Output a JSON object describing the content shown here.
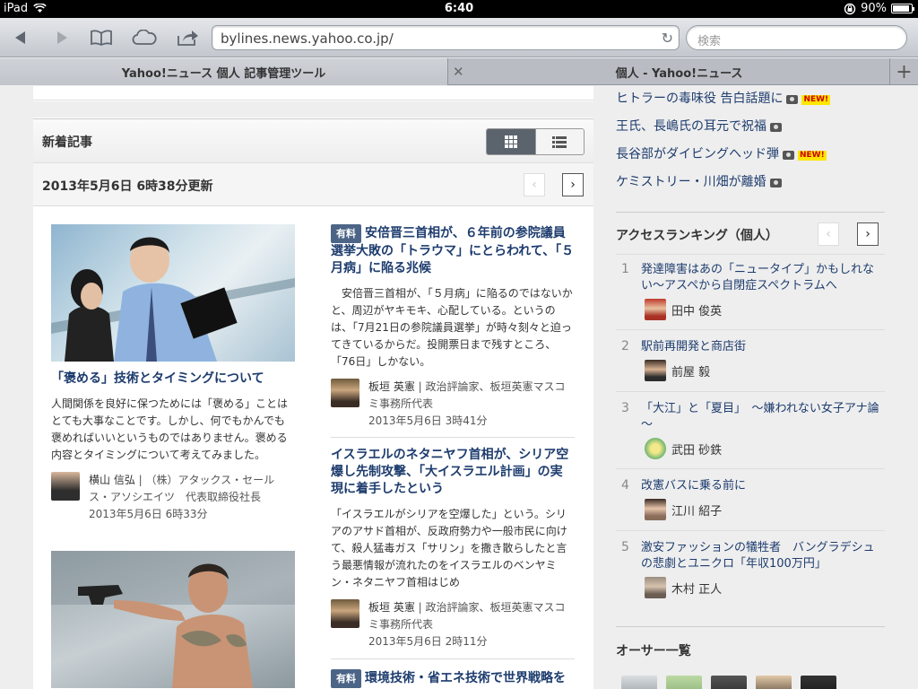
{
  "status_bar": {
    "device": "iPad",
    "time": "6:40",
    "battery": "90%",
    "battery_level": 0.9
  },
  "toolbar": {
    "url": "bylines.news.yahoo.co.jp/",
    "search_placeholder": "検索"
  },
  "tabs": [
    {
      "label": "Yahoo!ニュース 個人 記事管理ツール",
      "active": true
    },
    {
      "label": "個人 - Yahoo!ニュース",
      "active": false
    }
  ],
  "section": {
    "title": "新着記事",
    "updated": "2013年5月6日 6時38分更新"
  },
  "articles_left": [
    {
      "title": "「褒める」技術とタイミングについて",
      "body": "人間関係を良好に保つためには「褒める」ことはとても大事なことです。しかし、何でもかんでも褒めればいいというものではありません。褒める内容とタイミングについて考えてみました。",
      "author_name": "横山 信弘",
      "author_role": "（株）アタックス・セールス・アソシエイツ　代表取締役社長",
      "time": "2013年5月6日 6時33分"
    }
  ],
  "articles_right": [
    {
      "badge": "有料",
      "title": "安倍晋三首相が、６年前の参院議員選挙大敗の「トラウマ」にとらわれて、「５月病」に陥る兆候",
      "body": "安倍晋三首相が、「５月病」に陥るのではないかと、周辺がヤキモキ、心配している。というのは、「7月21日の参院議員選挙」が時々刻々と迫ってきているからだ。投開票日まで残すところ、「76日」しかない。",
      "author_name": "板垣 英憲",
      "author_role": "政治評論家、板垣英憲マスコミ事務所代表",
      "time": "2013年5月6日 3時41分"
    },
    {
      "badge": "",
      "title": "イスラエルのネタニヤフ首相が、シリア空爆し先制攻撃、「大イスラエル計画」の実現に着手したという",
      "body": "「イスラエルがシリアを空爆した」という。シリアのアサド首相が、反政府勢力や一般市民に向けて、殺人猛毒ガス「サリン」を撒き散らしたと言う最悪情報が流れたのをイスラエルのベンヤミン・ネタニヤフ首相はじめ",
      "author_name": "板垣 英憲",
      "author_role": "政治評論家、板垣英憲マスコミ事務所代表",
      "time": "2013年5月6日 2時11分"
    },
    {
      "badge": "有料",
      "title": "環境技術・省エネ技術で世界戦略を"
    }
  ],
  "topics": [
    {
      "title": "ヒトラーの毒味役 告白話題に",
      "new": true
    },
    {
      "title": "王氏、長嶋氏の耳元で祝福",
      "new": false
    },
    {
      "title": "長谷部がダイビングヘッド弾",
      "new": true
    },
    {
      "title": "ケミストリー・川畑が離婚",
      "new": false
    }
  ],
  "new_label": "NEW!",
  "ranking": {
    "title": "アクセスランキング（個人）",
    "items": [
      {
        "rank": "1",
        "title": "発達障害はあの「ニュータイプ」かもしれない～アスペから自閉症スペクトラムへ",
        "author": "田中 俊英"
      },
      {
        "rank": "2",
        "title": "駅前再開発と商店街",
        "author": "前屋 毅"
      },
      {
        "rank": "3",
        "title": "「大江」と「夏目」　～嫌われない女子アナ論～",
        "author": "武田 砂鉄"
      },
      {
        "rank": "4",
        "title": "改憲バスに乗る前に",
        "author": "江川 紹子"
      },
      {
        "rank": "5",
        "title": "激安ファッションの犠牲者　バングラデシュの悲劇とユニクロ「年収100万円」",
        "author": "木村 正人"
      }
    ]
  },
  "authors_section": {
    "title": "オーサー一覧"
  }
}
